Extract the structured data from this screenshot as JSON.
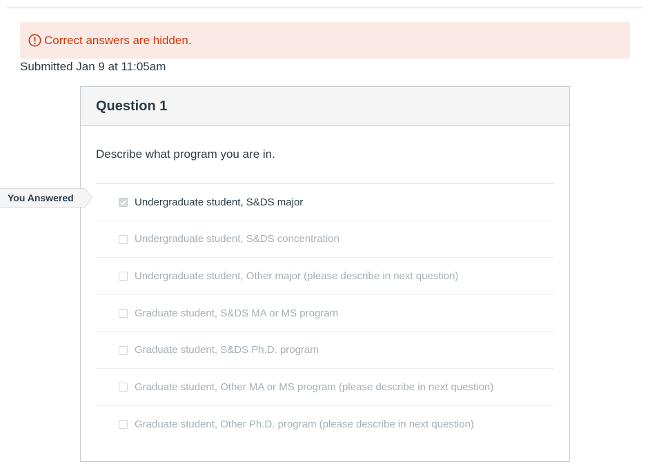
{
  "alert": {
    "icon": "exclamation-circle-icon",
    "text": "Correct answers are hidden.",
    "color": "#c23c0d",
    "background": "#fbe9e6"
  },
  "submission": {
    "text": "Submitted Jan 9 at 11:05am"
  },
  "question": {
    "title": "Question 1",
    "prompt": "Describe what program you are in.",
    "answers": [
      {
        "label": "Undergraduate student, S&DS major",
        "checked": true
      },
      {
        "label": "Undergraduate student, S&DS concentration",
        "checked": false
      },
      {
        "label": "Undergraduate student, Other major (please describe in next question)",
        "checked": false
      },
      {
        "label": "Graduate student, S&DS MA or MS program",
        "checked": false
      },
      {
        "label": "Graduate student, S&DS Ph.D. program",
        "checked": false
      },
      {
        "label": "Graduate student, Other MA or MS program (please describe in next question)",
        "checked": false
      },
      {
        "label": "Graduate student, Other Ph.D. program (please describe in next question)",
        "checked": false
      }
    ]
  },
  "marker": {
    "text": "You Answered"
  }
}
